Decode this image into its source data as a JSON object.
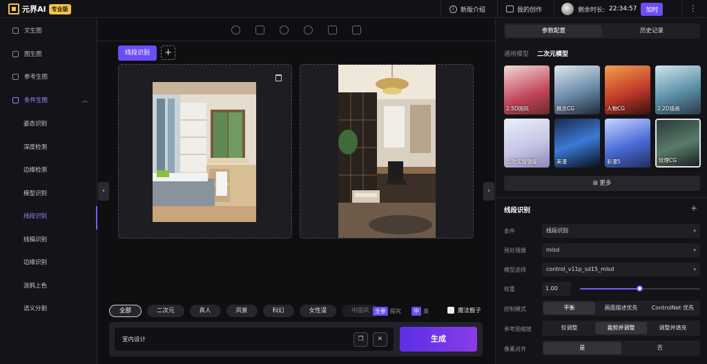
{
  "brand": {
    "name": "元界AI",
    "edition": "专业版"
  },
  "topbar": {
    "whats_new": "新版介绍",
    "my_creations": "我的创作",
    "remaining_label": "剩余时长:",
    "remaining_time": "22:34:57",
    "add_time": "加时"
  },
  "sidebar": {
    "items": [
      {
        "label": "文生图"
      },
      {
        "label": "图生图"
      },
      {
        "label": "参考生图"
      },
      {
        "label": "条件生图"
      }
    ],
    "sub_items": [
      {
        "label": "姿态识别"
      },
      {
        "label": "深度检测"
      },
      {
        "label": "边缘检测"
      },
      {
        "label": "模型识别"
      },
      {
        "label": "线段识别"
      },
      {
        "label": "线稿识别"
      },
      {
        "label": "边缘识别"
      },
      {
        "label": "涂鸦上色"
      },
      {
        "label": "语义分割"
      }
    ]
  },
  "canvas": {
    "tab_label": "线段识别",
    "add_tab": "+"
  },
  "styles": {
    "chips": [
      "全部",
      "二次元",
      "真人",
      "风景",
      "科幻",
      "女性漫",
      "中国风"
    ],
    "toggle1": {
      "on": "全参",
      "off": "探究"
    },
    "toggle2": {
      "on": "中",
      "off": "英"
    },
    "dice": "魔法骰子"
  },
  "prompt": {
    "value": "室内设计",
    "generate": "生成",
    "copy_icon": "copy-icon",
    "clear_icon": "close-icon"
  },
  "right_panel": {
    "tabs": [
      "参数配置",
      "历史记录"
    ],
    "model_tabs": [
      "通用模型",
      "二次元模型"
    ],
    "models": [
      {
        "label": "2.5D国风"
      },
      {
        "label": "概念CG"
      },
      {
        "label": "人物CG"
      },
      {
        "label": "2.2D插画"
      },
      {
        "label": "二次元增强版"
      },
      {
        "label": "美漫"
      },
      {
        "label": "彩漫5"
      },
      {
        "label": "纹理CG"
      }
    ],
    "more": "更多",
    "section_title": "线段识别",
    "section_add": "+",
    "rows": {
      "condition": {
        "label": "条件",
        "value": "线段识别"
      },
      "preprocessor": {
        "label": "预处理器",
        "value": "mlsd"
      },
      "model": {
        "label": "模型选择",
        "value": "control_v11p_sd15_mlsd"
      },
      "weight": {
        "label": "权重",
        "value": "1.00",
        "slider_fraction": 0.5
      },
      "control_mode": {
        "label": "控制模式",
        "options": [
          "平衡",
          "画面描述优先",
          "ControlNet 优先"
        ]
      },
      "resize": {
        "label": "参考图缩放",
        "options": [
          "仅调整",
          "裁剪并调整",
          "调整并填充"
        ]
      },
      "pixel_align": {
        "label": "像素对齐",
        "options": [
          "是",
          "否"
        ]
      }
    }
  }
}
